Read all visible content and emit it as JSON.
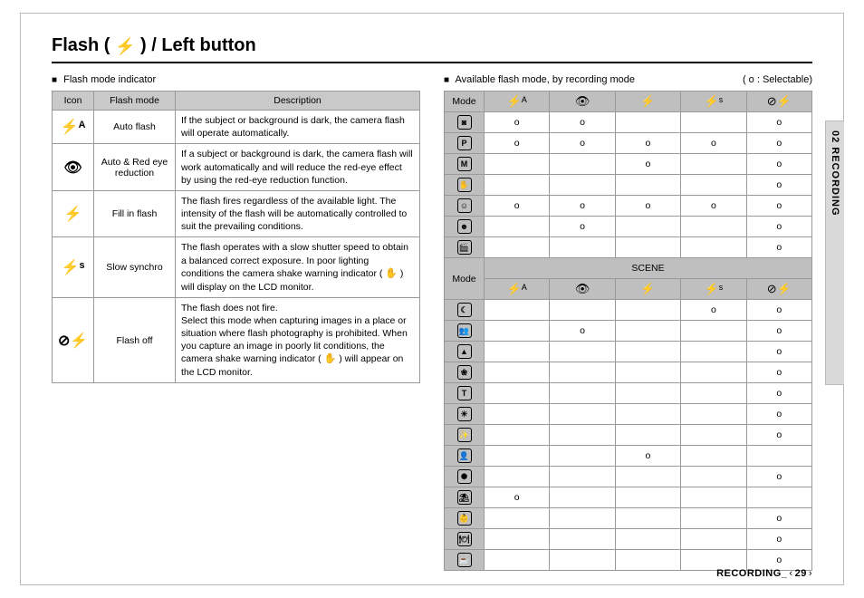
{
  "title_prefix": "Flash (",
  "title_suffix": ") / Left button",
  "title_icon": "⚡",
  "left": {
    "heading": "Flash mode indicator",
    "columns": [
      "Icon",
      "Flash mode",
      "Description"
    ],
    "rows": [
      {
        "icon": "⚡ᴬ",
        "mode": "Auto flash",
        "desc": "If the subject or background is dark, the camera flash will operate automatically."
      },
      {
        "icon": "👁",
        "mode": "Auto & Red eye reduction",
        "desc": "If a subject or background is dark, the camera flash will work automatically and will reduce the red-eye effect by using the red-eye reduction function."
      },
      {
        "icon": "⚡",
        "mode": "Fill in flash",
        "desc": "The flash fires regardless of the available light. The intensity of the flash will be automatically controlled to suit the prevailing conditions."
      },
      {
        "icon": "⚡ˢ",
        "mode": "Slow synchro",
        "desc_pre": "The flash operates with a slow shutter speed to obtain a balanced correct exposure. In poor lighting conditions the camera shake warning indicator ( ",
        "shake_icon": "✋",
        "desc_post": " ) will display on the LCD monitor."
      },
      {
        "icon": "⊘⚡",
        "mode": "Flash off",
        "desc_pre": "The flash does not fire.\nSelect this mode when capturing images in a place or situation where flash photography is prohibited. When you capture an image in poorly lit conditions, the camera shake warning indicator ( ",
        "shake_icon": "✋",
        "desc_post": " ) will appear on the LCD monitor."
      }
    ]
  },
  "right": {
    "heading": "Available flash mode, by recording mode",
    "legend": "( o : Selectable)",
    "mode_label": "Mode",
    "scene_label": "SCENE",
    "col_icons": [
      "⚡ᴬ",
      "👁",
      "⚡",
      "⚡ˢ",
      "⊘⚡"
    ],
    "top_rows": [
      {
        "icon": "◙",
        "cells": [
          "o",
          "o",
          "",
          "",
          "o"
        ]
      },
      {
        "icon": "P",
        "cells": [
          "o",
          "o",
          "o",
          "o",
          "o"
        ]
      },
      {
        "icon": "M",
        "cells": [
          "",
          "",
          "o",
          "",
          "o"
        ]
      },
      {
        "icon": "✋",
        "cells": [
          "",
          "",
          "",
          "",
          "o"
        ]
      },
      {
        "icon": "☺",
        "cells": [
          "o",
          "o",
          "o",
          "o",
          "o"
        ]
      },
      {
        "icon": "☻",
        "cells": [
          "",
          "o",
          "",
          "",
          "o"
        ]
      },
      {
        "icon": "🎬",
        "cells": [
          "",
          "",
          "",
          "",
          "o"
        ]
      }
    ],
    "scene_rows": [
      {
        "icon": "☾",
        "cells": [
          "",
          "",
          "",
          "o",
          "o"
        ]
      },
      {
        "icon": "👥",
        "cells": [
          "",
          "o",
          "",
          "",
          "o"
        ]
      },
      {
        "icon": "▲",
        "cells": [
          "",
          "",
          "",
          "",
          "o"
        ]
      },
      {
        "icon": "❀",
        "cells": [
          "",
          "",
          "",
          "",
          "o"
        ]
      },
      {
        "icon": "T",
        "cells": [
          "",
          "",
          "",
          "",
          "o"
        ]
      },
      {
        "icon": "☀",
        "cells": [
          "",
          "",
          "",
          "",
          "o"
        ]
      },
      {
        "icon": "✨",
        "cells": [
          "",
          "",
          "",
          "",
          "o"
        ]
      },
      {
        "icon": "👤",
        "cells": [
          "",
          "",
          "o",
          "",
          ""
        ]
      },
      {
        "icon": "✺",
        "cells": [
          "",
          "",
          "",
          "",
          "o"
        ]
      },
      {
        "icon": "⛱",
        "cells": [
          "o",
          "",
          "",
          "",
          ""
        ]
      },
      {
        "icon": "👶",
        "cells": [
          "",
          "",
          "",
          "",
          "o"
        ]
      },
      {
        "icon": "🍽",
        "cells": [
          "",
          "",
          "",
          "",
          "o"
        ]
      },
      {
        "icon": "☕",
        "cells": [
          "",
          "",
          "",
          "",
          "o"
        ]
      }
    ]
  },
  "side_tab": "02 RECORDING",
  "footer_label": "RECORDING_",
  "page_number": "29"
}
